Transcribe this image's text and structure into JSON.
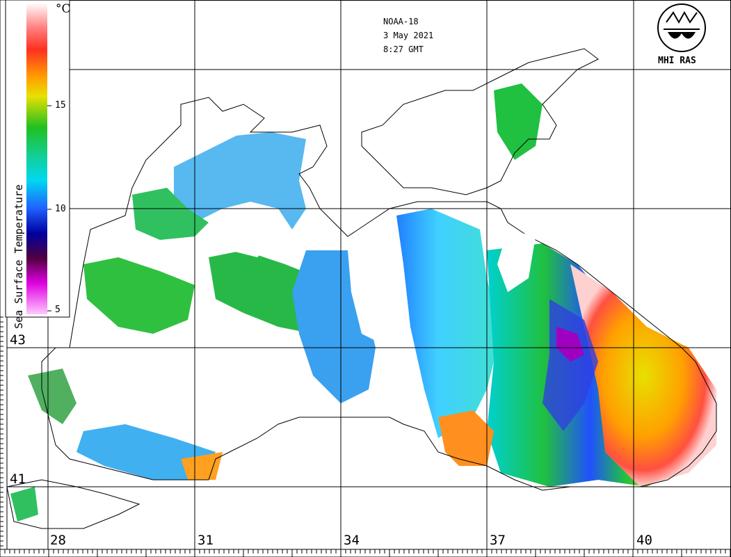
{
  "header": {
    "satellite": "NOAA-18",
    "date": "3 May 2021",
    "time": "8:27 GMT"
  },
  "logo": {
    "label": "MHI RAS",
    "glyph": "MHI",
    "icon": "mhi-ras-logo-icon"
  },
  "color_scale": {
    "title": "Sea Surface Temperature",
    "unit": "°C",
    "ticks": [
      "15",
      "10",
      "5"
    ],
    "colors": [
      "#ffffff",
      "#ff4040",
      "#ffa000",
      "#e8e000",
      "#20c020",
      "#00d8d8",
      "#2060ff",
      "#0000a0",
      "#500040",
      "#ff00ff",
      "#ffb0ff"
    ]
  },
  "axes": {
    "latitude_labels": [
      "43",
      "41"
    ],
    "longitude_labels": [
      "28",
      "31",
      "34",
      "37",
      "40"
    ]
  }
}
